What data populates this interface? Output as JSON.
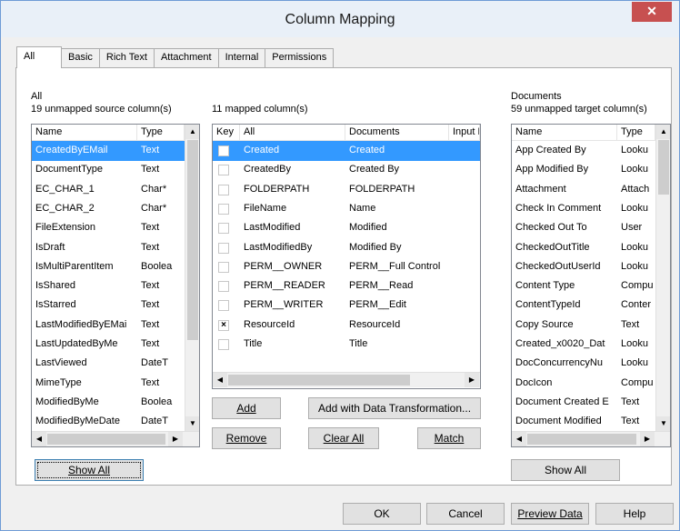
{
  "window": {
    "title": "Column Mapping",
    "close_glyph": "✕"
  },
  "tabs": [
    "All",
    "Basic",
    "Rich Text",
    "Attachment",
    "Internal",
    "Permissions"
  ],
  "source": {
    "group_label": "All",
    "count_label": "19 unmapped source column(s)",
    "columns": [
      "Name",
      "Type"
    ],
    "rows": [
      [
        "CreatedByEMail",
        "Text"
      ],
      [
        "DocumentType",
        "Text"
      ],
      [
        "EC_CHAR_1",
        "Char*"
      ],
      [
        "EC_CHAR_2",
        "Char*"
      ],
      [
        "FileExtension",
        "Text"
      ],
      [
        "IsDraft",
        "Text"
      ],
      [
        "IsMultiParentItem",
        "Boolea"
      ],
      [
        "IsShared",
        "Text"
      ],
      [
        "IsStarred",
        "Text"
      ],
      [
        "LastModifiedByEMai",
        "Text"
      ],
      [
        "LastUpdatedByMe",
        "Text"
      ],
      [
        "LastViewed",
        "DateT"
      ],
      [
        "MimeType",
        "Text"
      ],
      [
        "ModifiedByMe",
        "Boolea"
      ],
      [
        "ModifiedByMeDate",
        "DateT"
      ]
    ],
    "show_all_label": "Show All"
  },
  "mapped": {
    "count_label": "11 mapped column(s)",
    "columns": [
      "Key",
      "All",
      "Documents",
      "Input D"
    ],
    "rows": [
      {
        "key": false,
        "source": "Created",
        "target": "Created",
        "selected": true
      },
      {
        "key": false,
        "source": "CreatedBy",
        "target": "Created By"
      },
      {
        "key": false,
        "source": "FOLDERPATH",
        "target": "FOLDERPATH"
      },
      {
        "key": false,
        "source": "FileName",
        "target": "Name"
      },
      {
        "key": false,
        "source": "LastModified",
        "target": "Modified"
      },
      {
        "key": false,
        "source": "LastModifiedBy",
        "target": "Modified By"
      },
      {
        "key": false,
        "source": "PERM__OWNER",
        "target": "PERM__Full Control"
      },
      {
        "key": false,
        "source": "PERM__READER",
        "target": "PERM__Read"
      },
      {
        "key": false,
        "source": "PERM__WRITER",
        "target": "PERM__Edit"
      },
      {
        "key": true,
        "source": "ResourceId",
        "target": "ResourceId"
      },
      {
        "key": false,
        "source": "Title",
        "target": "Title"
      }
    ],
    "key_mark": "×",
    "buttons": {
      "add": "Add",
      "add_transform": "Add with Data Transformation...",
      "remove": "Remove",
      "clear_all": "Clear All",
      "match": "Match"
    }
  },
  "target": {
    "group_label": "Documents",
    "count_label": "59 unmapped target column(s)",
    "columns": [
      "Name",
      "Type"
    ],
    "rows": [
      [
        "App Created By",
        "Looku"
      ],
      [
        "App Modified By",
        "Looku"
      ],
      [
        "Attachment",
        "Attach"
      ],
      [
        "Check In Comment",
        "Looku"
      ],
      [
        "Checked Out To",
        "User"
      ],
      [
        "CheckedOutTitle",
        "Looku"
      ],
      [
        "CheckedOutUserId",
        "Looku"
      ],
      [
        "Content Type",
        "Compu"
      ],
      [
        "ContentTypeId",
        "Conter"
      ],
      [
        "Copy Source",
        "Text"
      ],
      [
        "Created_x0020_Dat",
        "Looku"
      ],
      [
        "DocConcurrencyNu",
        "Looku"
      ],
      [
        "DocIcon",
        "Compu"
      ],
      [
        "Document Created E",
        "Text"
      ],
      [
        "Document Modified",
        "Text"
      ]
    ],
    "show_all_label": "Show All"
  },
  "footer": {
    "ok": "OK",
    "cancel": "Cancel",
    "preview": "Preview Data",
    "help": "Help"
  },
  "colors": {
    "selection": "#3399ff",
    "close": "#c75050",
    "titlebar": "#e9f0f8"
  }
}
